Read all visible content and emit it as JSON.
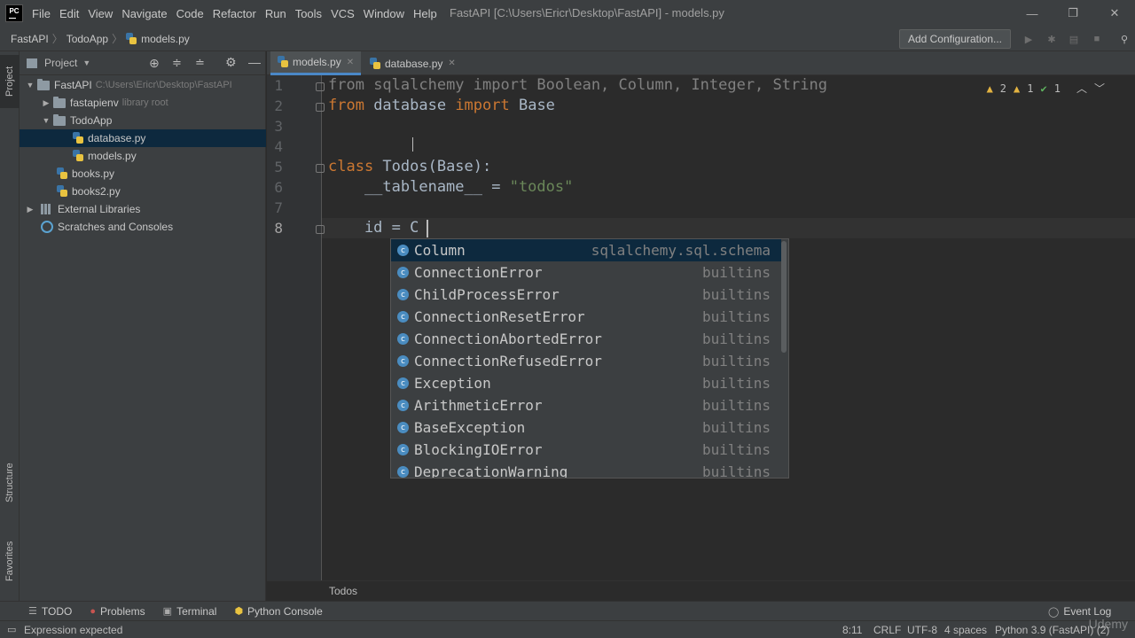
{
  "menubar": {
    "logo": "PC",
    "items": [
      "File",
      "Edit",
      "View",
      "Navigate",
      "Code",
      "Refactor",
      "Run",
      "Tools",
      "VCS",
      "Window",
      "Help"
    ],
    "title": "FastAPI [C:\\Users\\Ericr\\Desktop\\FastAPI] - models.py",
    "minimize": "—",
    "restore": "❐",
    "close": "✕"
  },
  "navbar": {
    "crumbs": [
      "FastAPI",
      "TodoApp",
      "models.py"
    ],
    "add_config": "Add Configuration..."
  },
  "left_strip": {
    "project": "Project",
    "structure": "Structure",
    "favorites": "Favorites"
  },
  "project_panel": {
    "title": "Project",
    "tree": [
      {
        "label": "FastAPI",
        "hint": "C:\\Users\\Ericr\\Desktop\\FastAPI"
      },
      {
        "label": "fastapienv",
        "hint": "library root"
      },
      {
        "label": "TodoApp"
      },
      {
        "label": "database.py"
      },
      {
        "label": "models.py"
      },
      {
        "label": "books.py"
      },
      {
        "label": "books2.py"
      },
      {
        "label": "External Libraries"
      },
      {
        "label": "Scratches and Consoles"
      }
    ]
  },
  "tabs": [
    {
      "label": "models.py",
      "active": true
    },
    {
      "label": "database.py",
      "active": false
    }
  ],
  "editor": {
    "line_numbers": [
      "1",
      "2",
      "3",
      "4",
      "5",
      "6",
      "7",
      "8"
    ],
    "lines": {
      "l1_kw": "from",
      "l1_rest": " sqlalchemy import Boolean, Column, Integer, String",
      "l2_kw1": "from",
      "l2_mid": " database ",
      "l2_kw2": "import",
      "l2_rest": " Base",
      "l5_kw": "class",
      "l5_rest": " Todos(Base):",
      "l6_name": "    __tablename__ = ",
      "l6_str": "\"todos\"",
      "l8": "    id = C"
    },
    "inspections": {
      "warnings": "2",
      "weak_warnings": "1",
      "ok": "1"
    }
  },
  "completion": [
    {
      "name": "Column",
      "source": "sqlalchemy.sql.schema"
    },
    {
      "name": "ConnectionError",
      "source": "builtins"
    },
    {
      "name": "ChildProcessError",
      "source": "builtins"
    },
    {
      "name": "ConnectionResetError",
      "source": "builtins"
    },
    {
      "name": "ConnectionAbortedError",
      "source": "builtins"
    },
    {
      "name": "ConnectionRefusedError",
      "source": "builtins"
    },
    {
      "name": "Exception",
      "source": "builtins"
    },
    {
      "name": "ArithmeticError",
      "source": "builtins"
    },
    {
      "name": "BaseException",
      "source": "builtins"
    },
    {
      "name": "BlockingIOError",
      "source": "builtins"
    },
    {
      "name": "DeprecationWarning",
      "source": "builtins"
    }
  ],
  "code_breadcrumb": "Todos",
  "bottom_tabs": [
    {
      "icon": "☰",
      "label": "TODO"
    },
    {
      "icon": "●",
      "label": "Problems"
    },
    {
      "icon": "▣",
      "label": "Terminal"
    },
    {
      "icon": "⬢",
      "label": "Python Console"
    }
  ],
  "event_log": "Event Log",
  "status": {
    "message": "Expression expected",
    "position": "8:11",
    "line_sep": "CRLF",
    "encoding": "UTF-8",
    "indent": "4 spaces",
    "interpreter": "Python 3.9 (FastAPI) (2)"
  },
  "watermark": "Udemy",
  "colors": {
    "keyword": "#cc7832",
    "string": "#6a8759",
    "selection": "#0d293e",
    "accent": "#4a88c7"
  }
}
